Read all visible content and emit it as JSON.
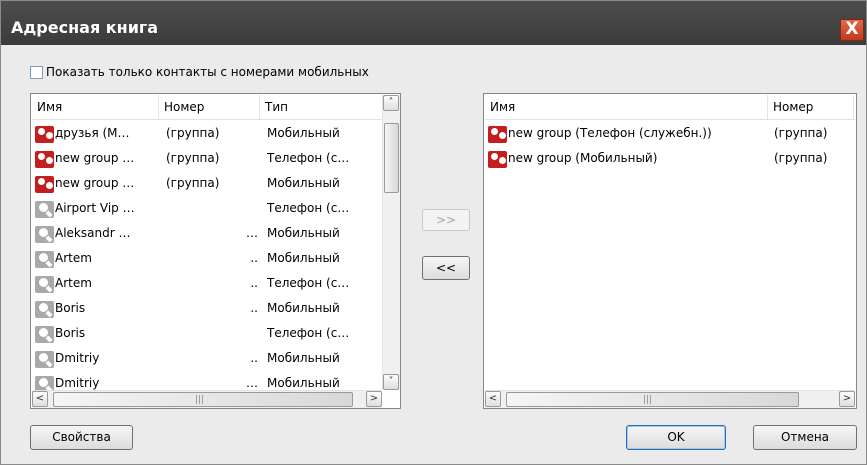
{
  "window": {
    "title": "Адресная книга",
    "close_label": "X"
  },
  "filter": {
    "label": "Показать только контакты с номерами мобильных",
    "checked": false
  },
  "left_list": {
    "headers": {
      "name": "Имя",
      "number": "Номер",
      "type": "Тип"
    },
    "rows": [
      {
        "icon": "group-icon",
        "name": "друзья (М…",
        "number": "(группа)",
        "type": "Мобильный"
      },
      {
        "icon": "group-icon",
        "name": "new group …",
        "number": "(группа)",
        "type": "Телефон (с…"
      },
      {
        "icon": "group-icon",
        "name": "new group …",
        "number": "(группа)",
        "type": "Мобильный"
      },
      {
        "icon": "contact-icon",
        "name": "Airport Vip …",
        "number": "",
        "type": "Телефон (с…"
      },
      {
        "icon": "contact-icon",
        "name": "Aleksandr …",
        "number": "…",
        "type": "Мобильный"
      },
      {
        "icon": "contact-icon",
        "name": "Artem",
        "number": "..",
        "type": "Мобильный"
      },
      {
        "icon": "contact-icon",
        "name": "Artem",
        "number": "..",
        "type": "Телефон (с…"
      },
      {
        "icon": "contact-icon",
        "name": "Boris",
        "number": "..",
        "type": "Мобильный"
      },
      {
        "icon": "contact-icon",
        "name": "Boris",
        "number": "",
        "type": "Телефон (с…"
      },
      {
        "icon": "contact-icon",
        "name": "Dmitriy",
        "number": "..",
        "type": "Мобильный"
      },
      {
        "icon": "contact-icon",
        "name": "Dmitriy",
        "number": "…",
        "type": "Мобильный"
      }
    ]
  },
  "right_list": {
    "headers": {
      "name": "Имя",
      "number": "Номер"
    },
    "rows": [
      {
        "icon": "group-icon",
        "name": "new group (Телефон (служебн.))",
        "number": "(группа)"
      },
      {
        "icon": "group-icon",
        "name": "new group (Мобильный)",
        "number": "(группа)"
      }
    ]
  },
  "transfer": {
    "add_label": ">>",
    "remove_label": "<<"
  },
  "buttons": {
    "properties": "Свойства",
    "ok": "OK",
    "cancel": "Отмена"
  },
  "scroll": {
    "up": "˄",
    "down": "˅",
    "left": "<",
    "right": ">",
    "grip": "|||"
  },
  "colors": {
    "titlebar": "#3f3f3f",
    "close": "#d04a2a",
    "group_icon": "#c31f1f",
    "contact_icon": "#a9a9a9"
  }
}
